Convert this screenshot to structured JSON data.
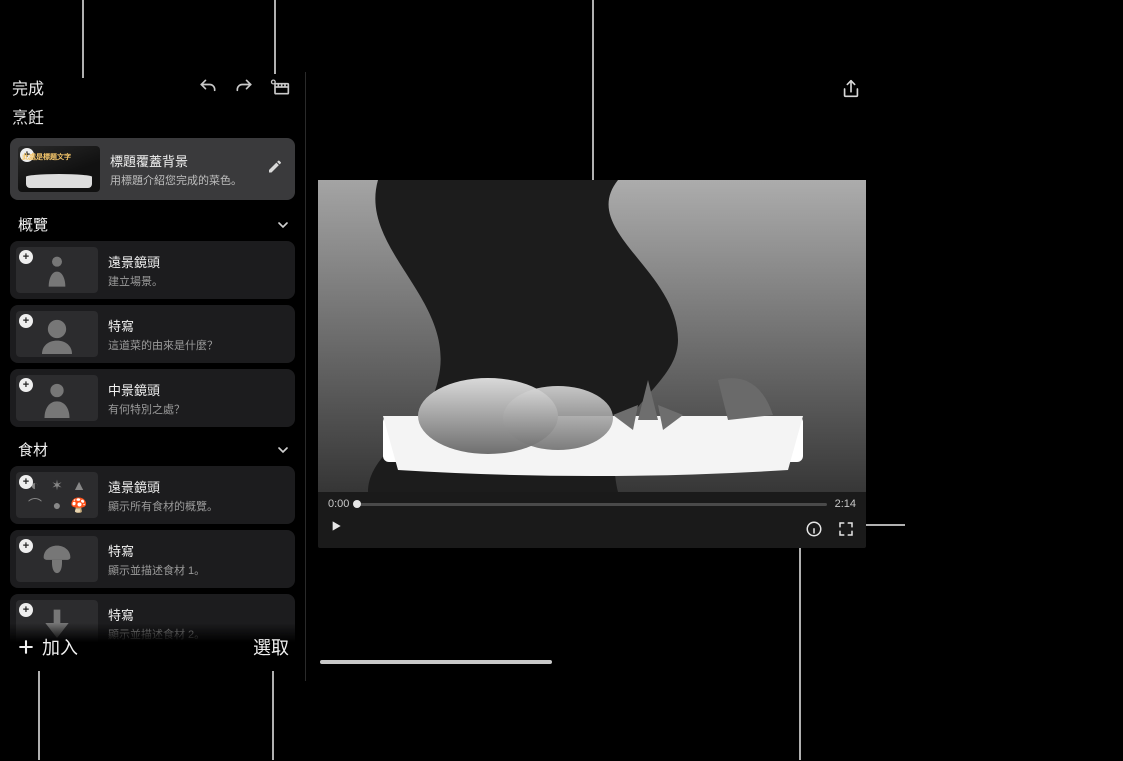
{
  "header": {
    "done_label": "完成",
    "project_title": "烹飪"
  },
  "title_card": {
    "thumb_overlay": "此處是標題文字",
    "title": "標題覆蓋背景",
    "subtitle": "用標題介紹您完成的菜色。"
  },
  "sections": [
    {
      "name": "概覽",
      "clips": [
        {
          "kind": "silhouette-full",
          "title": "遠景鏡頭",
          "subtitle": "建立場景。"
        },
        {
          "kind": "silhouette-shoulders",
          "title": "特寫",
          "subtitle": "這道菜的由來是什麼？"
        },
        {
          "kind": "silhouette-bust",
          "title": "中景鏡頭",
          "subtitle": "有何特別之處？"
        }
      ]
    },
    {
      "name": "食材",
      "clips": [
        {
          "kind": "ingredients-grid",
          "title": "遠景鏡頭",
          "subtitle": "顯示所有食材的概覽。"
        },
        {
          "kind": "mushroom",
          "title": "特寫",
          "subtitle": "顯示並描述食材 1。"
        },
        {
          "kind": "arrow-down",
          "title": "特寫",
          "subtitle": "顯示並描述食材 2。"
        }
      ]
    }
  ],
  "bottom_bar": {
    "add_label": "加入",
    "select_label": "選取"
  },
  "preview": {
    "time_current": "0:00",
    "time_total": "2:14"
  }
}
